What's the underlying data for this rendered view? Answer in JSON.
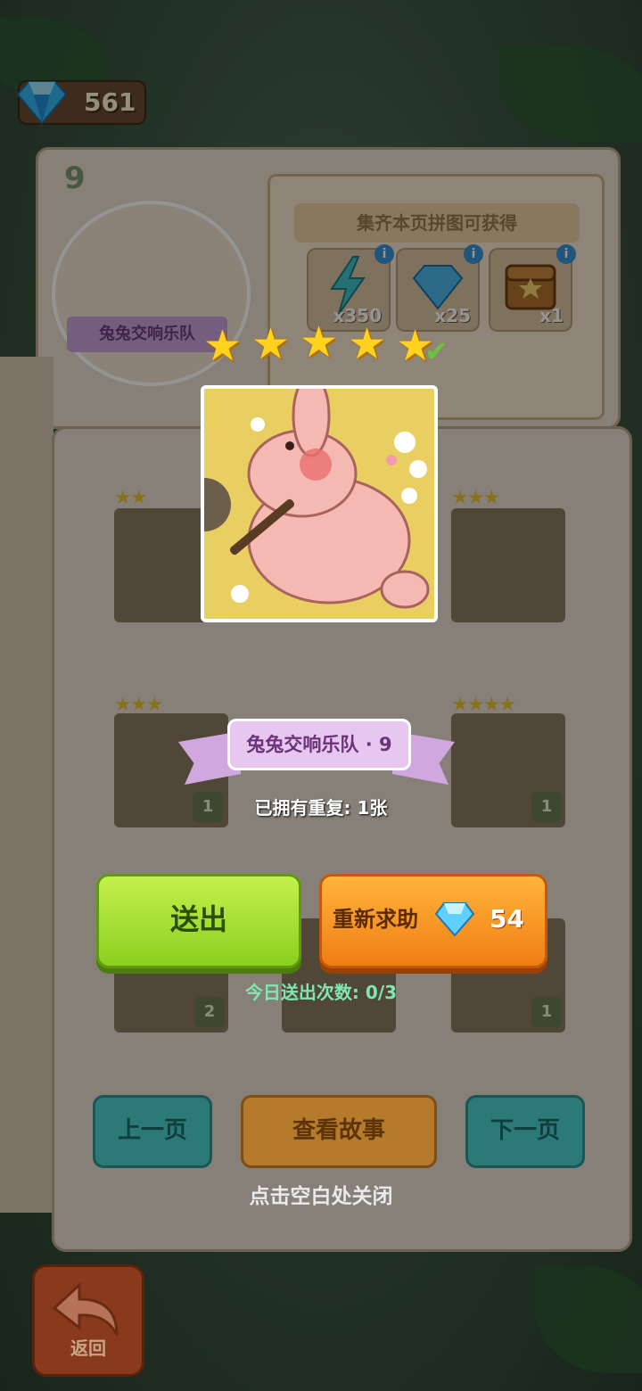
{
  "currency": {
    "gems": "561"
  },
  "album": {
    "page_number": "9",
    "badge_name": "兔兔交响乐队",
    "reward_title": "集齐本页拼图可获得",
    "rewards": [
      {
        "icon": "lightning-icon",
        "qty": "x350"
      },
      {
        "icon": "gem-icon",
        "qty": "x25"
      },
      {
        "icon": "treasure-chest-icon",
        "qty": "x1"
      }
    ],
    "info_glyph": "i"
  },
  "slots": [
    {
      "stars": "★★",
      "count": ""
    },
    {
      "stars": "★★★",
      "count": ""
    },
    {
      "stars": "★★★",
      "count": "1"
    },
    {
      "stars": "★★★★",
      "count": "1"
    },
    {
      "stars": "",
      "count": "2"
    },
    {
      "stars": "",
      "count": "1"
    }
  ],
  "piece": {
    "name": "兔兔交响乐队 · 9",
    "stars": 5,
    "owned_text": "已拥有重复: 1张"
  },
  "actions": {
    "send_label": "送出",
    "help_label": "重新求助",
    "help_cost": "54",
    "daily_send": "今日送出次数: 0/3"
  },
  "nav": {
    "prev_label": "上一页",
    "story_label": "查看故事",
    "next_label": "下一页",
    "close_hint": "点击空白处关闭"
  },
  "back": {
    "label": "返回"
  },
  "colors": {
    "send_green": "#8bcf1f",
    "help_orange": "#f07d14",
    "star_yellow": "#ffd21f",
    "daily_text": "#7fe8b0"
  }
}
